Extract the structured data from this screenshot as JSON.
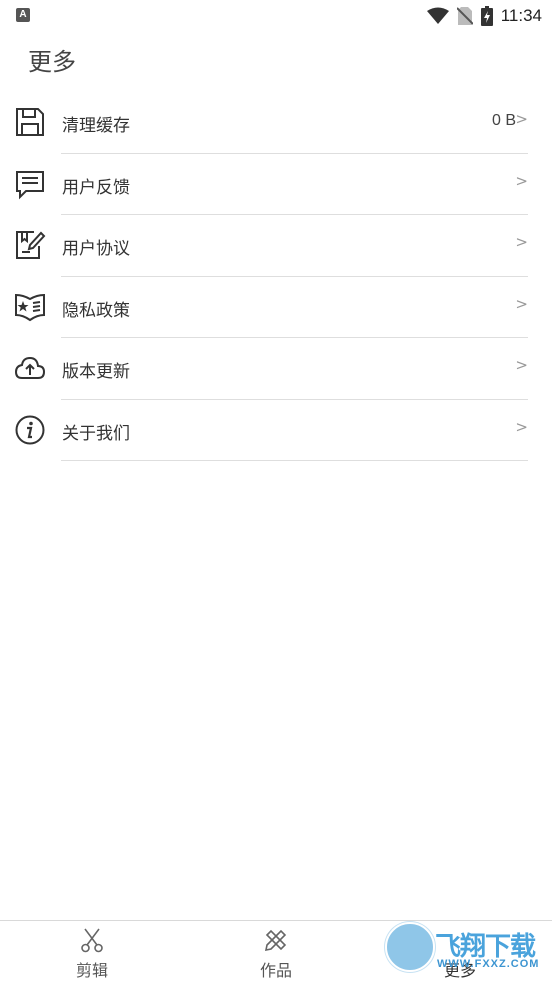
{
  "status_bar": {
    "badge": "A",
    "time": "11:34",
    "icons": [
      "wifi-icon",
      "no-sim-icon",
      "battery-charging-icon"
    ]
  },
  "page": {
    "title": "更多"
  },
  "menu": {
    "items": [
      {
        "label": "清理缓存",
        "value": "0 B",
        "icon": "save-disk-icon"
      },
      {
        "label": "用户反馈",
        "value": "",
        "icon": "chat-bubble-icon"
      },
      {
        "label": "用户协议",
        "value": "",
        "icon": "edit-document-icon"
      },
      {
        "label": "隐私政策",
        "value": "",
        "icon": "star-book-icon"
      },
      {
        "label": "版本更新",
        "value": "",
        "icon": "cloud-upload-icon"
      },
      {
        "label": "关于我们",
        "value": "",
        "icon": "info-circle-icon"
      }
    ],
    "chevron": ">"
  },
  "tab_bar": {
    "tabs": [
      {
        "label": "剪辑",
        "icon": "scissors-icon"
      },
      {
        "label": "作品",
        "icon": "pencil-ruler-icon"
      },
      {
        "label": "更多",
        "icon": "more-icon",
        "active": true
      }
    ]
  },
  "watermark": {
    "text": "飞翔下载",
    "url": "WWW.FXXZ.COM"
  },
  "colors": {
    "text": "#333333",
    "divider": "#dedede",
    "chevron": "#999999",
    "watermark": "#4aa3dc"
  }
}
